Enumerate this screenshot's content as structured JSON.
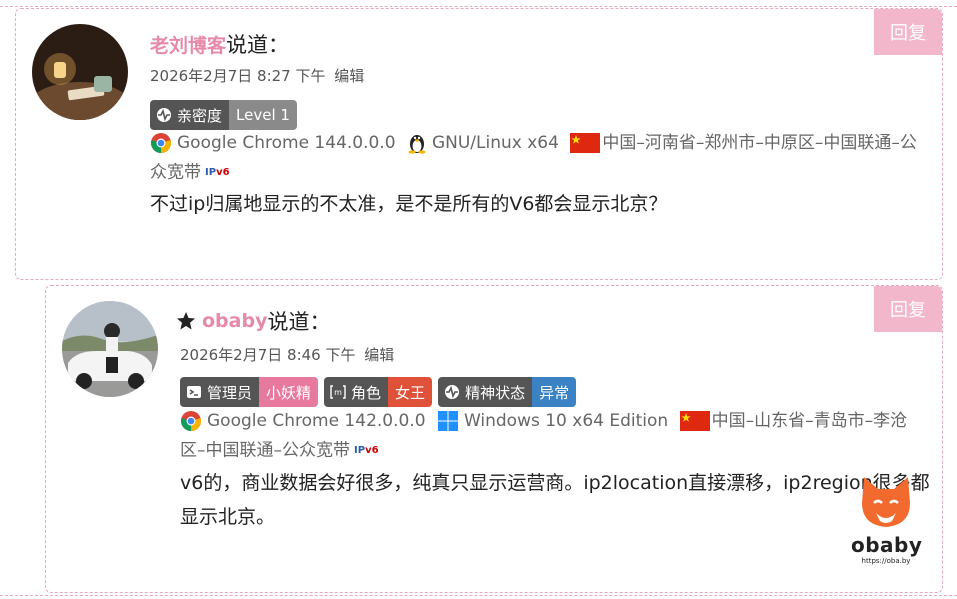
{
  "comments": [
    {
      "reply_label": "回复",
      "author": "老刘博客",
      "said": "说道：",
      "date": "2026年2月7日 8:27 下午",
      "edit": "编辑",
      "badges": [
        {
          "label": "亲密度",
          "value": "Level 1",
          "color": "#8a8a8a",
          "icon": "pulse-icon"
        }
      ],
      "browser": "Google Chrome 144.0.0.0",
      "os": "GNU/Linux x64",
      "location": "中国–河南省–郑州市–中原区–中国联通–公众宽带",
      "body": "不过ip归属地显示的不太准，是不是所有的V6都会显示北京？"
    },
    {
      "reply_label": "回复",
      "author": "obaby",
      "said": "说道：",
      "date": "2026年2月7日 8:46 下午",
      "edit": "编辑",
      "badges": [
        {
          "label": "管理员",
          "value": "小妖精",
          "color": "#e7799e",
          "icon": "admin-icon"
        },
        {
          "label": "角色",
          "value": "女王",
          "color": "#e0513a",
          "icon": "role-icon"
        },
        {
          "label": "精神状态",
          "value": "异常",
          "color": "#3b82c4",
          "icon": "pulse-icon"
        }
      ],
      "browser": "Google Chrome 142.0.0.0",
      "os": "Windows 10 x64 Edition",
      "location": "中国–山东省–青岛市–李沧区–中国联通–公众宽带",
      "body": "v6的，商业数据会好很多，纯真只显示运营商。ip2location直接漂移，ip2region很多都显示北京。"
    }
  ],
  "watermark": {
    "text": "obaby",
    "url": "https://oba.by"
  }
}
